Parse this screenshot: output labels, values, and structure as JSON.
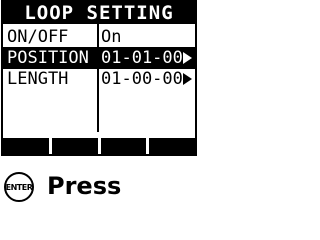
{
  "screen": {
    "title": "LOOP SETTING",
    "rows": [
      {
        "label": "ON/OFF",
        "value": "On"
      },
      {
        "label": "POSITION",
        "value": "01-01-00"
      },
      {
        "label": "LENGTH",
        "value": "01-00-00"
      }
    ],
    "selected_row": "POSITION",
    "arrow_icon": "triangle-right-icon"
  },
  "instruction": {
    "button_label": "ENTER",
    "action_text": "Press"
  },
  "colors": {
    "lcd_foreground": "#000000",
    "lcd_background": "#ffffff"
  }
}
